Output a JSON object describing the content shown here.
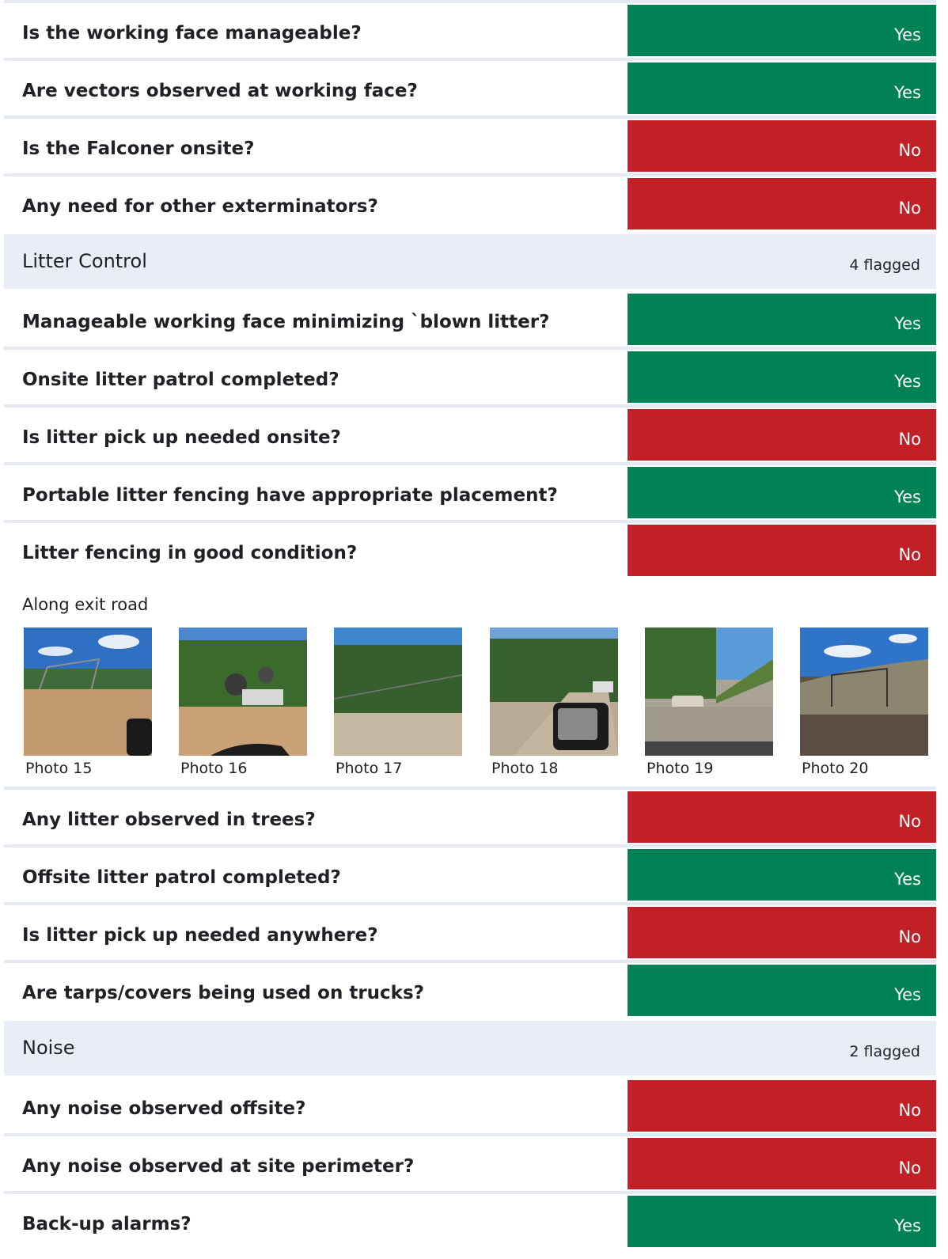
{
  "colors": {
    "yes": "#008254",
    "no": "#c21f26",
    "section_bg": "#e9eef6",
    "divider": "#e4e9f1"
  },
  "rows_a": [
    {
      "question": "Is the working face manageable?",
      "answer": "Yes"
    },
    {
      "question": "Are vectors observed at working face?",
      "answer": "Yes"
    },
    {
      "question": "Is the Falconer onsite?",
      "answer": "No"
    },
    {
      "question": "Any need for other exterminators?",
      "answer": "No"
    }
  ],
  "litter_section": {
    "title": "Litter Control",
    "flagged": "4 flagged"
  },
  "rows_b": [
    {
      "question": "Manageable working face minimizing `blown litter?",
      "answer": "Yes"
    },
    {
      "question": "Onsite litter patrol completed?",
      "answer": "Yes"
    },
    {
      "question": "Is litter pick up needed onsite?",
      "answer": "No"
    },
    {
      "question": "Portable litter fencing have appropriate placement?",
      "answer": "Yes"
    },
    {
      "question": "Litter fencing in good condition?",
      "answer": "No"
    }
  ],
  "fencing_note": "Along exit road",
  "photos": [
    {
      "caption": "Photo 15"
    },
    {
      "caption": "Photo 16"
    },
    {
      "caption": "Photo 17"
    },
    {
      "caption": "Photo 18"
    },
    {
      "caption": "Photo 19"
    },
    {
      "caption": "Photo 20"
    }
  ],
  "rows_c": [
    {
      "question": "Any litter observed in trees?",
      "answer": "No"
    },
    {
      "question": "Offsite litter patrol completed?",
      "answer": "Yes"
    },
    {
      "question": "Is litter pick up needed anywhere?",
      "answer": "No"
    },
    {
      "question": "Are tarps/covers being used on trucks?",
      "answer": "Yes"
    }
  ],
  "noise_section": {
    "title": "Noise",
    "flagged": "2 flagged"
  },
  "rows_d": [
    {
      "question": "Any noise observed offsite?",
      "answer": "No"
    },
    {
      "question": "Any noise observed at site perimeter?",
      "answer": "No"
    },
    {
      "question": "Back-up alarms?",
      "answer": "Yes"
    }
  ]
}
